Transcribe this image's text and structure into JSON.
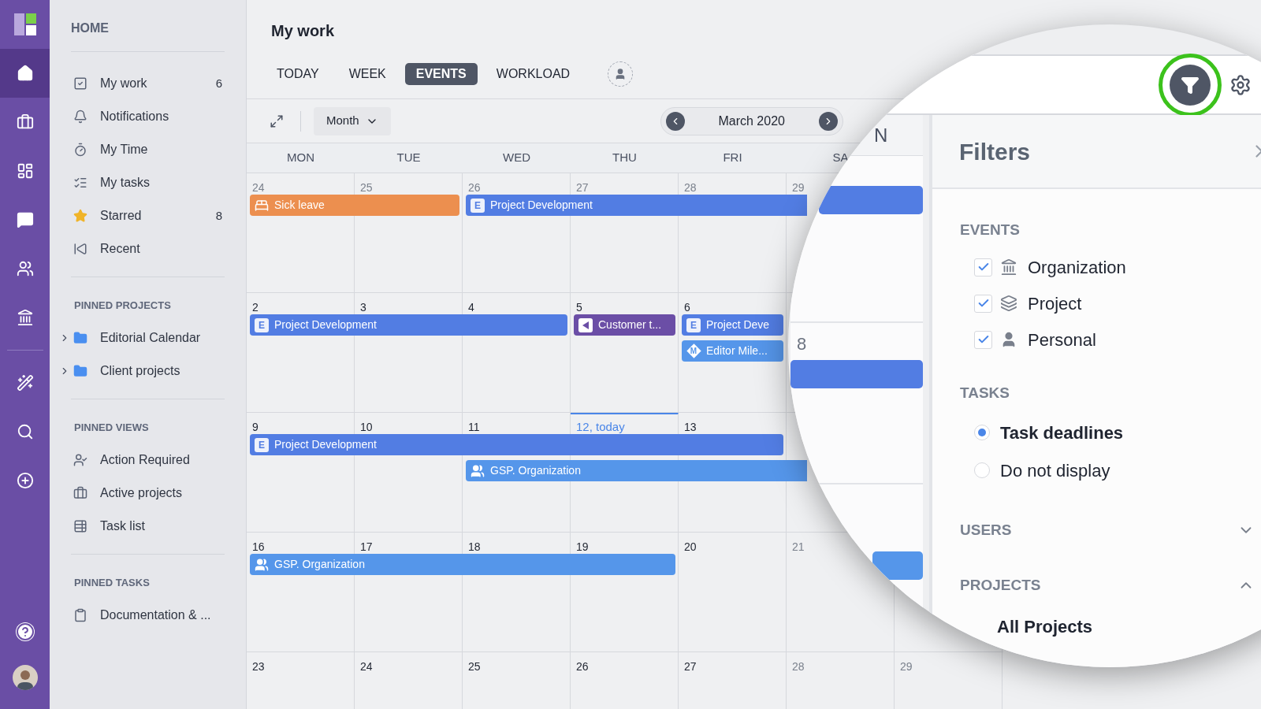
{
  "rail": {
    "items": [
      {
        "kind": "home",
        "selected": true
      },
      {
        "kind": "briefcase",
        "selected": false
      },
      {
        "kind": "board",
        "selected": false
      },
      {
        "kind": "chat",
        "selected": false
      },
      {
        "kind": "people",
        "selected": false
      },
      {
        "kind": "bank",
        "selected": false
      },
      {
        "kind": "wand",
        "selected": false
      },
      {
        "kind": "search",
        "selected": false
      },
      {
        "kind": "add",
        "selected": false
      }
    ],
    "bottom": [
      {
        "kind": "help"
      },
      {
        "kind": "avatar"
      }
    ]
  },
  "sidebar": {
    "title": "HOME",
    "items": [
      {
        "kind": "check",
        "label": "My work",
        "count": "6"
      },
      {
        "kind": "bell",
        "label": "Notifications"
      },
      {
        "kind": "timer",
        "label": "My Time"
      },
      {
        "kind": "tasks",
        "label": "My tasks"
      },
      {
        "kind": "star",
        "label": "Starred",
        "count": "8"
      },
      {
        "kind": "recent",
        "label": "Recent"
      }
    ],
    "sections": [
      {
        "title": "PINNED PROJECTS",
        "items": [
          {
            "kind": "folder",
            "label": "Editorial Calendar",
            "expanded": false
          },
          {
            "kind": "folder",
            "label": "Client projects",
            "expanded": false
          }
        ]
      },
      {
        "title": "PINNED VIEWS",
        "items": [
          {
            "kind": "user-alert",
            "label": "Action Required"
          },
          {
            "kind": "briefcase",
            "label": "Active projects"
          },
          {
            "kind": "table",
            "label": "Task list"
          }
        ]
      },
      {
        "title": "PINNED TASKS",
        "items": [
          {
            "kind": "clipboard",
            "label": "Documentation & ..."
          }
        ]
      }
    ]
  },
  "header": {
    "title": "My work",
    "tabs": [
      {
        "label": "TODAY",
        "selected": false
      },
      {
        "label": "WEEK",
        "selected": false
      },
      {
        "label": "EVENTS",
        "selected": true
      },
      {
        "label": "WORKLOAD",
        "selected": false
      }
    ]
  },
  "toolbar": {
    "view": "Month",
    "period": "March 2020"
  },
  "calendar": {
    "weekdays": [
      "MON",
      "TUE",
      "WED",
      "THU",
      "FRI",
      "SA"
    ],
    "weeks": [
      {
        "days": [
          {
            "label": "24",
            "muted": true
          },
          {
            "label": "25",
            "muted": true
          },
          {
            "label": "26",
            "muted": true
          },
          {
            "label": "27",
            "muted": true
          },
          {
            "label": "28",
            "muted": true
          },
          {
            "label": "29",
            "muted": true
          }
        ],
        "lanes": [
          [
            {
              "kind": "sick",
              "title": "Sick leave",
              "color": "#ec8f4f"
            },
            {
              "kind": "badge",
              "badge": "E",
              "title": "Project Development",
              "color": "#527de3"
            }
          ]
        ]
      },
      {
        "days": [
          {
            "label": "2",
            "muted": false
          },
          {
            "label": "3",
            "muted": false
          },
          {
            "label": "4",
            "muted": false
          },
          {
            "label": "5",
            "muted": false
          },
          {
            "label": "6",
            "muted": false
          }
        ],
        "lanes": [
          [
            {
              "kind": "badge",
              "badge": "E",
              "title": "Project Development",
              "color": "#527de3"
            },
            {
              "kind": "flag",
              "title": "Customer t...",
              "color": "#6b4ea6"
            },
            {
              "kind": "badge",
              "badge": "E",
              "title": "Project Deve",
              "color": "#527de3"
            }
          ],
          [
            {
              "kind": "milestone",
              "badge": "M",
              "title": "Editor Mile...",
              "color": "#5596ea"
            }
          ]
        ]
      },
      {
        "days": [
          {
            "label": "9",
            "muted": false
          },
          {
            "label": "10",
            "muted": false
          },
          {
            "label": "11",
            "muted": false
          },
          {
            "label": "12, today",
            "muted": false,
            "today": true
          },
          {
            "label": "13",
            "muted": false
          }
        ],
        "lanes": [
          [
            {
              "kind": "badge",
              "badge": "E",
              "title": "Project Development",
              "color": "#527de3"
            }
          ],
          [
            {
              "kind": "group",
              "title": "GSP. Organization",
              "color": "#5596ea"
            }
          ]
        ]
      },
      {
        "days": [
          {
            "label": "16",
            "muted": false
          },
          {
            "label": "17",
            "muted": false
          },
          {
            "label": "18",
            "muted": false
          },
          {
            "label": "19",
            "muted": false
          },
          {
            "label": "20",
            "muted": false
          },
          {
            "label": "21",
            "muted": true
          }
        ],
        "lanes": [
          [
            {
              "kind": "group",
              "title": "GSP. Organization",
              "color": "#5596ea"
            }
          ]
        ]
      },
      {
        "days": [
          {
            "label": "23",
            "muted": false
          },
          {
            "label": "24",
            "muted": false
          },
          {
            "label": "25",
            "muted": false
          },
          {
            "label": "26",
            "muted": false
          },
          {
            "label": "27",
            "muted": false
          },
          {
            "label": "28",
            "muted": true
          },
          {
            "label": "29",
            "muted": true
          }
        ]
      }
    ]
  },
  "lens": {
    "filter_button": {
      "highlighted": true
    },
    "weekday": "N",
    "day": "8",
    "bars": [
      {
        "color": "#527de3"
      },
      {
        "color": "#527de3"
      },
      {
        "color": "#5596ea"
      }
    ],
    "filters": {
      "title": "Filters",
      "sections": [
        {
          "kind": "checks",
          "title": "EVENTS",
          "items": [
            {
              "kind": "bank",
              "label": "Organization",
              "checked": true
            },
            {
              "kind": "layers",
              "label": "Project",
              "checked": true
            },
            {
              "kind": "person",
              "label": "Personal",
              "checked": true
            }
          ]
        },
        {
          "kind": "radios",
          "title": "TASKS",
          "items": [
            {
              "label": "Task deadlines",
              "selected": true
            },
            {
              "label": "Do not display",
              "selected": false
            }
          ]
        },
        {
          "kind": "collapsible",
          "title": "USERS",
          "expanded": false
        },
        {
          "kind": "collapsible",
          "title": "PROJECTS",
          "expanded": true,
          "items": [
            {
              "label": "All Projects",
              "selected": true
            }
          ]
        }
      ]
    }
  }
}
